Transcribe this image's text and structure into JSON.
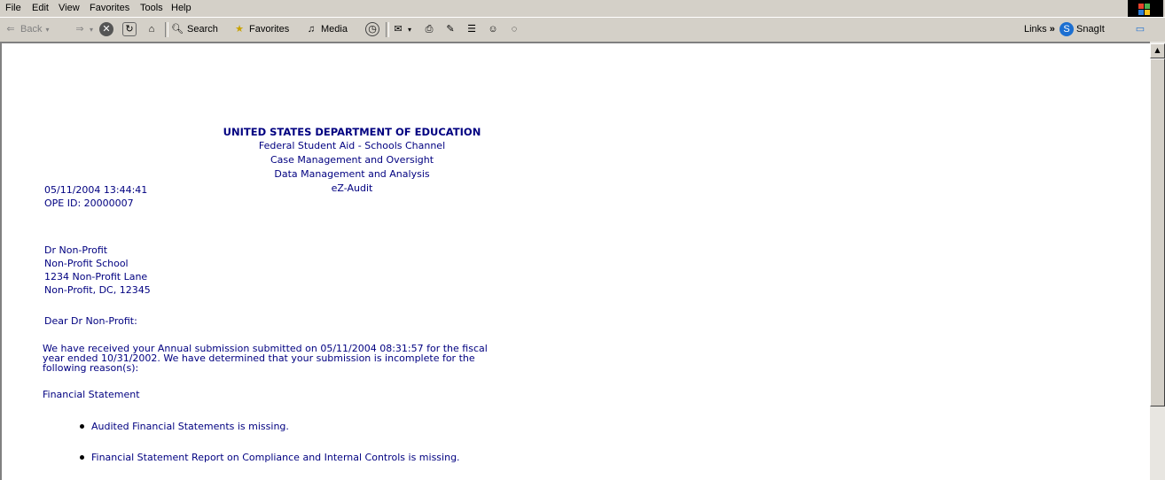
{
  "menu": [
    "File",
    "Edit",
    "View",
    "Favorites",
    "Tools",
    "Help"
  ],
  "toolbar": {
    "back": "Back",
    "search": "Search",
    "favorites": "Favorites",
    "media": "Media",
    "links": "Links",
    "snagit": "SnagIt"
  },
  "letter": {
    "agency": "UNITED STATES DEPARTMENT OF EDUCATION",
    "header_lines": [
      "Federal Student Aid - Schools Channel",
      "Case Management and Oversight",
      "Data Management and Analysis",
      "eZ-Audit"
    ],
    "datetime": "05/11/2004 13:44:41",
    "ope_id": "OPE ID: 20000007",
    "address": [
      "Dr Non-Profit",
      "Non-Profit School",
      "1234 Non-Profit Lane",
      "Non-Profit, DC, 12345"
    ],
    "salutation": "Dear Dr Non-Profit:",
    "body_lines": [
      "We have received your Annual submission submitted on 05/11/2004 08:31:57 for the fiscal",
      "year ended 10/31/2002.  We have determined that your submission is incomplete for the",
      "following reason(s):"
    ],
    "section": "Financial Statement",
    "reasons": [
      "Audited Financial Statements is missing.",
      "Financial Statement Report on Compliance and Internal Controls is missing."
    ]
  }
}
